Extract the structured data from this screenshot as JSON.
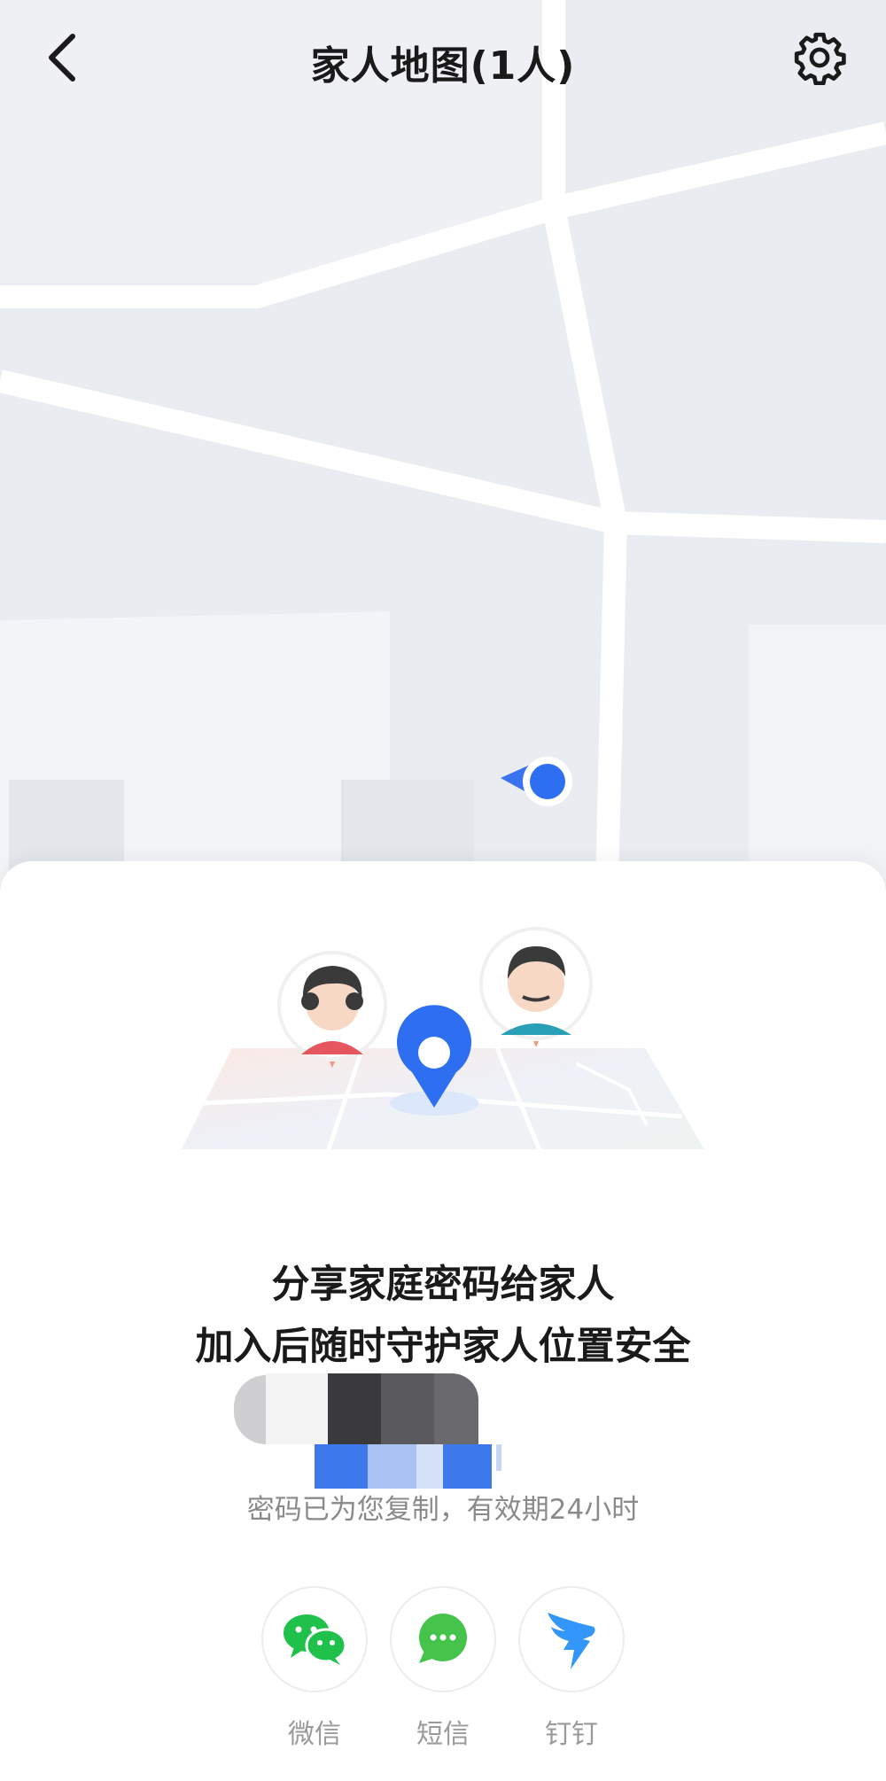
{
  "header": {
    "title": "家人地图(1人)"
  },
  "icons": {
    "back": "chevron-left-icon",
    "settings": "gear-icon",
    "location": "location-dot-icon"
  },
  "card": {
    "headline_line1": "分享家庭密码给家人",
    "headline_line2": "加入后随时守护家人位置安全",
    "copied_notice": "密码已为您复制，有效期24小时"
  },
  "share": [
    {
      "label": "微信",
      "icon": "wechat-icon",
      "color": "#20c14a"
    },
    {
      "label": "短信",
      "icon": "sms-icon",
      "color": "#45c34a"
    },
    {
      "label": "钉钉",
      "icon": "dingtalk-icon",
      "color": "#3296fa"
    }
  ],
  "colors": {
    "map_background": "#e9ecf1",
    "road": "#ffffff",
    "accent": "#2d6ff0"
  }
}
